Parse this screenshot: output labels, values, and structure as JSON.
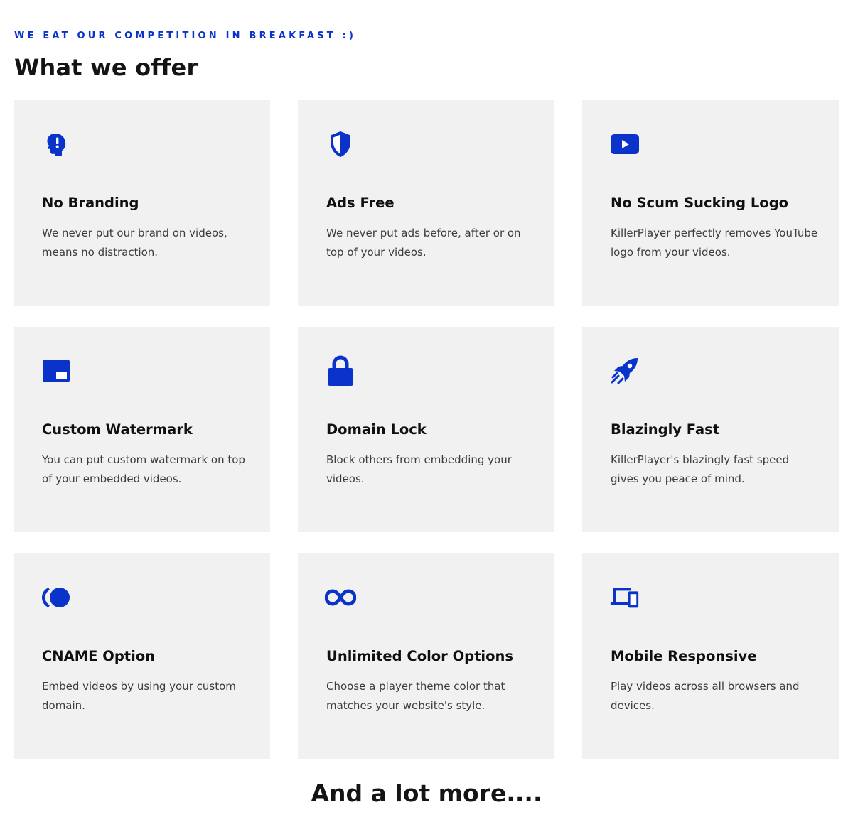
{
  "header": {
    "eyebrow": "WE EAT OUR COMPETITION IN BREAKFAST :)",
    "title": "What we offer"
  },
  "accent_color": "#0a33c9",
  "card_background": "#f1f1f1",
  "features": [
    {
      "icon": "head-exclamation-icon",
      "title": "No Branding",
      "description": "We never put our brand on videos, means no distraction."
    },
    {
      "icon": "shield-icon",
      "title": "Ads Free",
      "description": "We never put ads before, after or on top of your videos."
    },
    {
      "icon": "youtube-play-icon",
      "title": "No Scum Sucking Logo",
      "description": "KillerPlayer perfectly removes YouTube logo from your videos."
    },
    {
      "icon": "watermark-icon",
      "title": "Custom Watermark",
      "description": "You can put custom watermark on top of your embedded videos."
    },
    {
      "icon": "lock-icon",
      "title": "Domain Lock",
      "description": "Block others from embedding your videos."
    },
    {
      "icon": "rocket-icon",
      "title": "Blazingly Fast",
      "description": "KillerPlayer's blazingly fast speed gives you peace of mind."
    },
    {
      "icon": "cname-circle-icon",
      "title": "CNAME Option",
      "description": "Embed videos by using your custom domain."
    },
    {
      "icon": "infinity-icon",
      "title": "Unlimited Color Options",
      "description": "Choose a player theme color that matches your website's style."
    },
    {
      "icon": "devices-icon",
      "title": "Mobile Responsive",
      "description": "Play videos across all browsers and devices."
    }
  ],
  "footer": {
    "more_text": "And a lot more...."
  }
}
